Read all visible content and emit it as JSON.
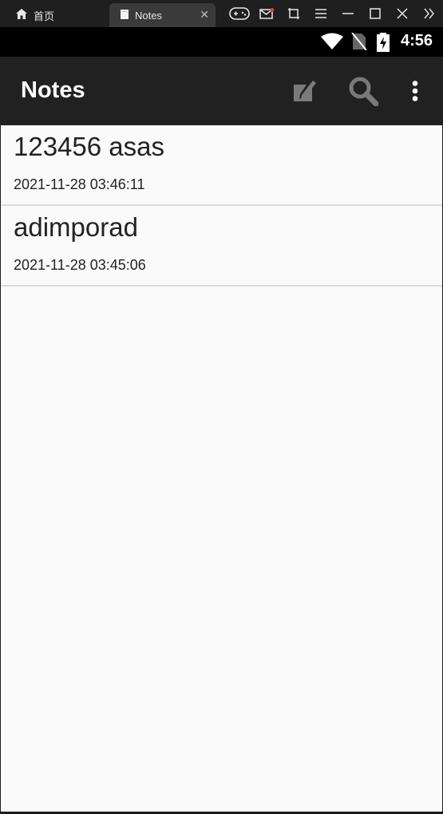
{
  "emulator": {
    "tabs": [
      {
        "label": "首页",
        "active": false
      },
      {
        "label": "Notes",
        "active": true
      }
    ],
    "icons": [
      "gamepad-icon",
      "mail-icon",
      "screenshot-icon",
      "menu-icon",
      "minimize-icon",
      "maximize-icon",
      "close-icon",
      "more-icon"
    ],
    "notification_dot_color": "#e53935"
  },
  "status_bar": {
    "time": "4:56",
    "icons": [
      "wifi-icon",
      "no-sim-icon",
      "battery-charging-icon"
    ]
  },
  "app_bar": {
    "title": "Notes",
    "actions": [
      "new-note-icon",
      "search-icon",
      "overflow-menu-icon"
    ]
  },
  "notes": [
    {
      "title": "123456 asas",
      "date": "2021-11-28 03:46:11"
    },
    {
      "title": "adimporad",
      "date": "2021-11-28 03:45:06"
    }
  ],
  "colors": {
    "app_bar_bg": "#212121",
    "status_bar_bg": "#000000",
    "list_bg": "#fafafa",
    "divider": "#dcdcdc"
  }
}
